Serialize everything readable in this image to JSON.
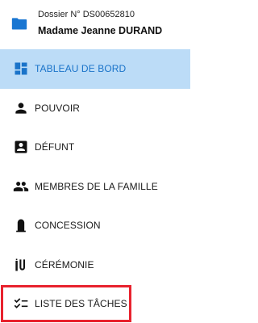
{
  "dossier": {
    "number": "Dossier N° DS00652810",
    "client": "Madame Jeanne DURAND"
  },
  "colors": {
    "accent": "#1a73c9",
    "active_bg": "#bcdcf7",
    "highlight_border": "#e8222e"
  },
  "nav": {
    "items": [
      {
        "label": "TABLEAU DE BORD",
        "icon": "dashboard-icon",
        "active": true
      },
      {
        "label": "POUVOIR",
        "icon": "person-icon"
      },
      {
        "label": "DÉFUNT",
        "icon": "account-box-icon"
      },
      {
        "label": "MEMBRES DE LA FAMILLE",
        "icon": "people-icon"
      },
      {
        "label": "CONCESSION",
        "icon": "tombstone-icon"
      },
      {
        "label": "CÉRÉMONIE",
        "icon": "ceremony-icon"
      },
      {
        "label": "LISTE DES TÂCHES",
        "icon": "checklist-icon",
        "highlighted": true
      }
    ]
  }
}
